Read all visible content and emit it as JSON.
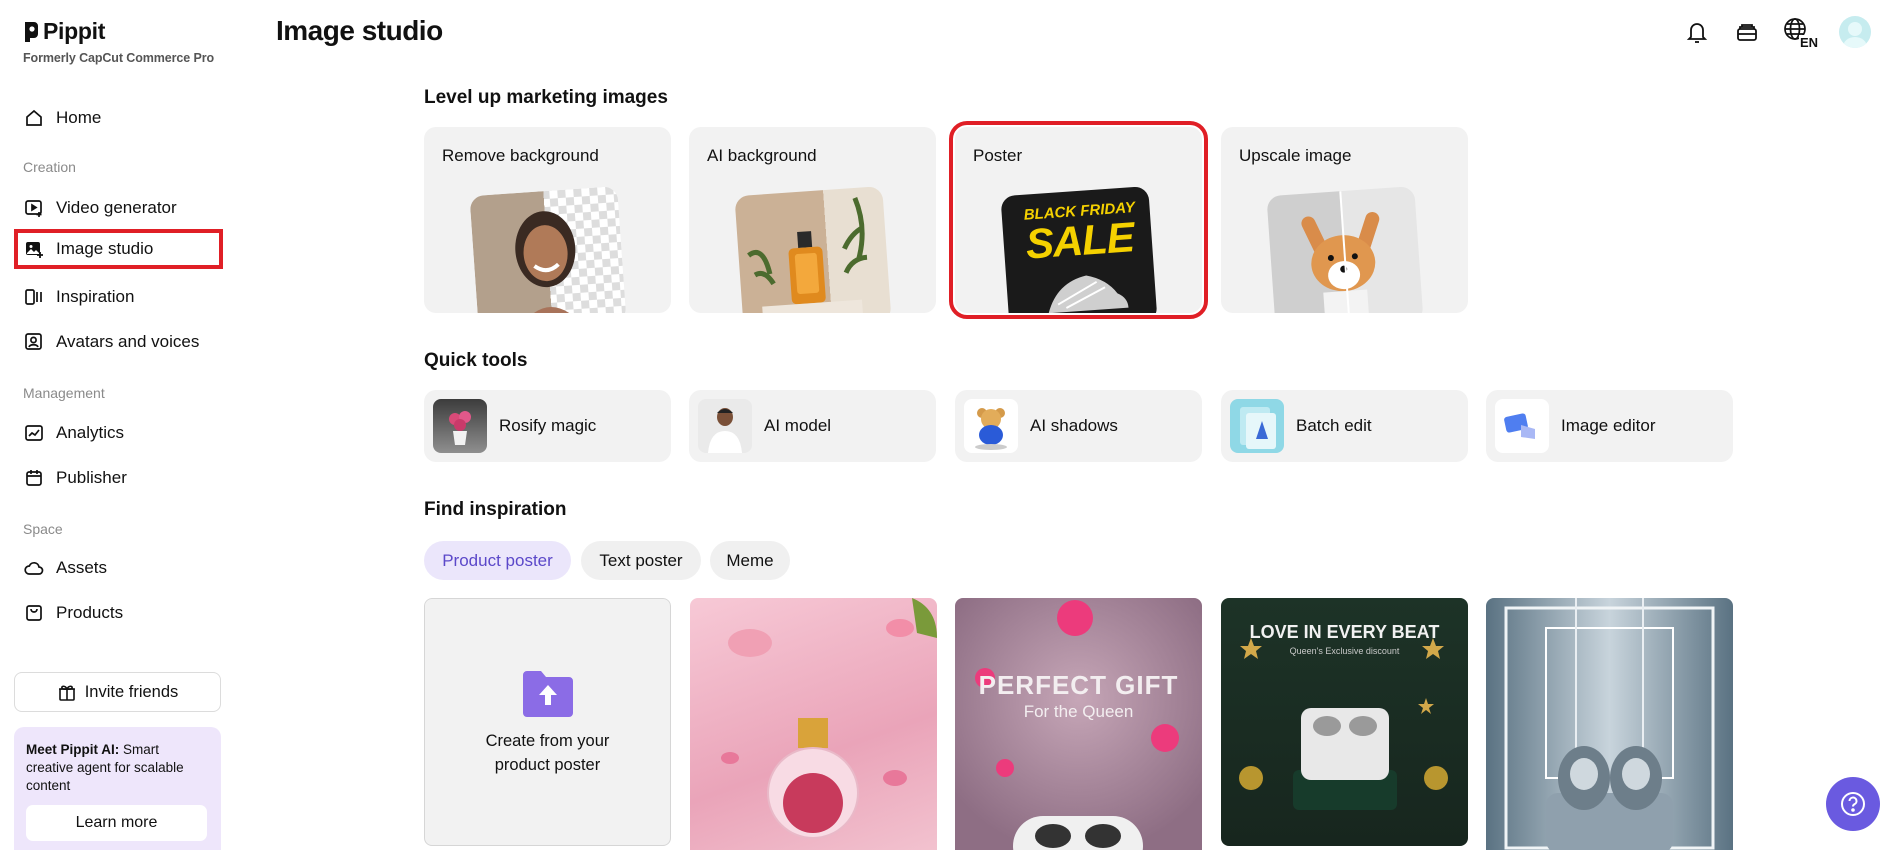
{
  "brand": {
    "name": "Pippit",
    "subtitle": "Formerly CapCut Commerce Pro"
  },
  "header": {
    "title": "Image studio",
    "lang_label": "EN",
    "icons": [
      "bell-icon",
      "stack-icon",
      "globe-icon",
      "avatar"
    ]
  },
  "sidebar": {
    "home": "Home",
    "section_creation": "Creation",
    "video_generator": "Video generator",
    "image_studio": "Image studio",
    "inspiration": "Inspiration",
    "avatars_voices": "Avatars and voices",
    "section_management": "Management",
    "analytics": "Analytics",
    "publisher": "Publisher",
    "section_space": "Space",
    "assets": "Assets",
    "products": "Products",
    "invite": "Invite friends",
    "promo_bold": "Meet Pippit AI:",
    "promo_text": " Smart creative agent for scalable content",
    "learn_more": "Learn more"
  },
  "marketing": {
    "title": "Level up marketing images",
    "cards": [
      {
        "label": "Remove background"
      },
      {
        "label": "AI background"
      },
      {
        "label": "Poster",
        "thumb_top": "BLACK FRIDAY",
        "thumb_main": "SALE"
      },
      {
        "label": "Upscale image"
      }
    ]
  },
  "quick_tools": {
    "title": "Quick tools",
    "items": [
      {
        "label": "Rosify magic"
      },
      {
        "label": "AI model"
      },
      {
        "label": "AI shadows"
      },
      {
        "label": "Batch edit"
      },
      {
        "label": "Image editor"
      }
    ]
  },
  "inspiration": {
    "title": "Find inspiration",
    "tabs": [
      "Product poster",
      "Text poster",
      "Meme"
    ],
    "active_tab": "Product poster",
    "create_label": "Create from your product poster",
    "posters": [
      {
        "id": "perfume"
      },
      {
        "headline": "PERFECT GIFT",
        "sub": "For the Queen"
      },
      {
        "headline": "LOVE IN EVERY BEAT",
        "sub": "Queen's Exclusive discount"
      },
      {
        "id": "earbuds"
      }
    ]
  },
  "colors": {
    "accent": "#6a5ae0",
    "highlight": "#e01f26",
    "card_bg": "#f2f2f2"
  }
}
